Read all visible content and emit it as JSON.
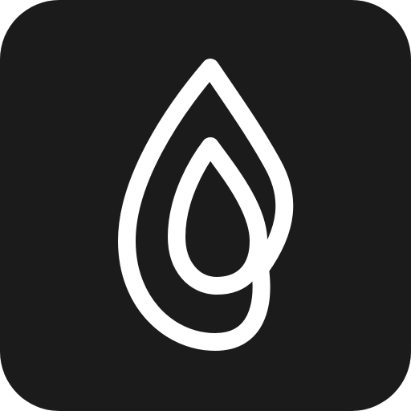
{
  "app_icon": {
    "icon": "nested-droplet-icon",
    "background_color": "#1b1b1b",
    "glyph_color": "#ffffff"
  }
}
